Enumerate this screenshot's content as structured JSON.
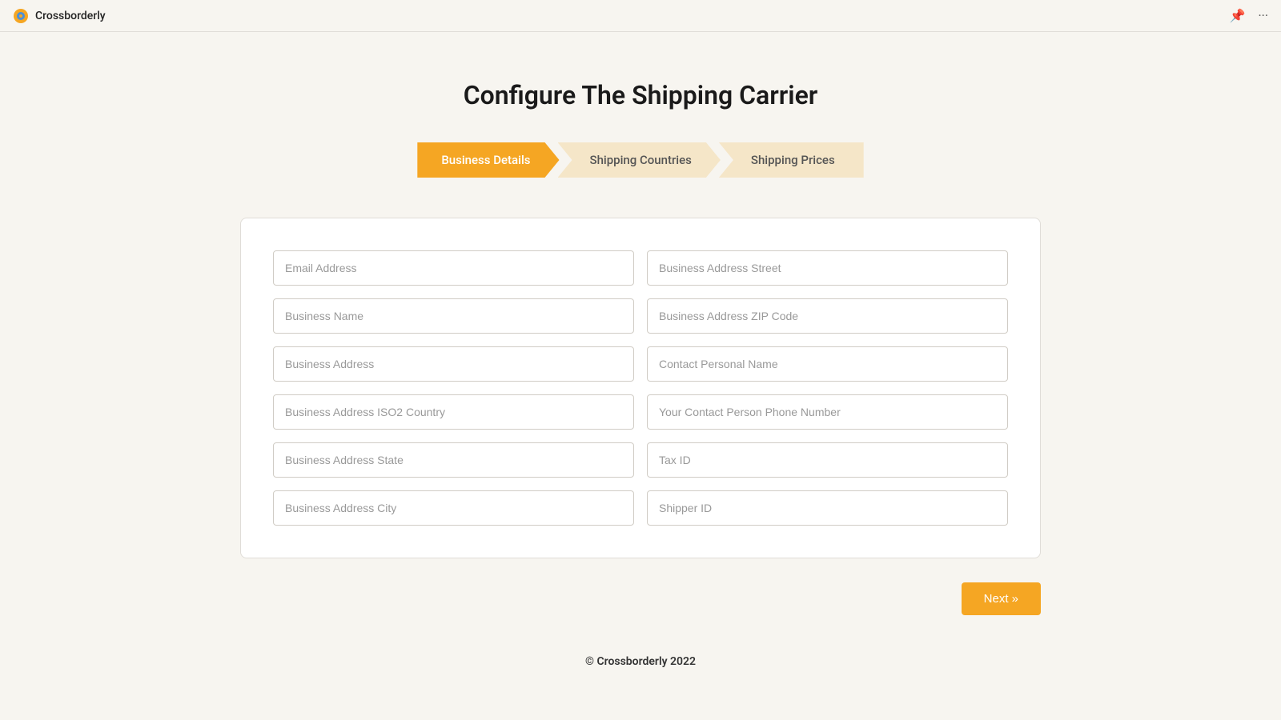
{
  "topbar": {
    "app_name": "Crossborderly",
    "pin_icon": "📌",
    "more_icon": "···"
  },
  "page": {
    "title": "Configure The Shipping Carrier",
    "footer": "© Crossborderly 2022"
  },
  "stepper": {
    "steps": [
      {
        "id": "business-details",
        "label": "Business Details",
        "active": true
      },
      {
        "id": "shipping-countries",
        "label": "Shipping Countries",
        "active": false
      },
      {
        "id": "shipping-prices",
        "label": "Shipping Prices",
        "active": false
      }
    ]
  },
  "form": {
    "left_fields": [
      {
        "id": "email-address",
        "placeholder": "Email Address",
        "value": ""
      },
      {
        "id": "business-name",
        "placeholder": "Business Name",
        "value": ""
      },
      {
        "id": "business-address",
        "placeholder": "Business Address",
        "value": ""
      },
      {
        "id": "business-address-iso2-country",
        "placeholder": "Business Address ISO2 Country",
        "value": ""
      },
      {
        "id": "business-address-state",
        "placeholder": "Business Address State",
        "value": ""
      },
      {
        "id": "business-address-city",
        "placeholder": "Business Address City",
        "value": ""
      }
    ],
    "right_fields": [
      {
        "id": "business-address-street",
        "placeholder": "Business Address Street",
        "value": ""
      },
      {
        "id": "business-address-zip",
        "placeholder": "Business Address ZIP Code",
        "value": ""
      },
      {
        "id": "contact-personal-name",
        "placeholder": "Contact Personal Name",
        "value": ""
      },
      {
        "id": "contact-phone-number",
        "placeholder": "Your Contact Person Phone Number",
        "value": ""
      },
      {
        "id": "tax-id",
        "placeholder": "Tax ID",
        "value": ""
      },
      {
        "id": "shipper-id",
        "placeholder": "Shipper ID",
        "value": ""
      }
    ]
  },
  "buttons": {
    "next_label": "Next »"
  }
}
